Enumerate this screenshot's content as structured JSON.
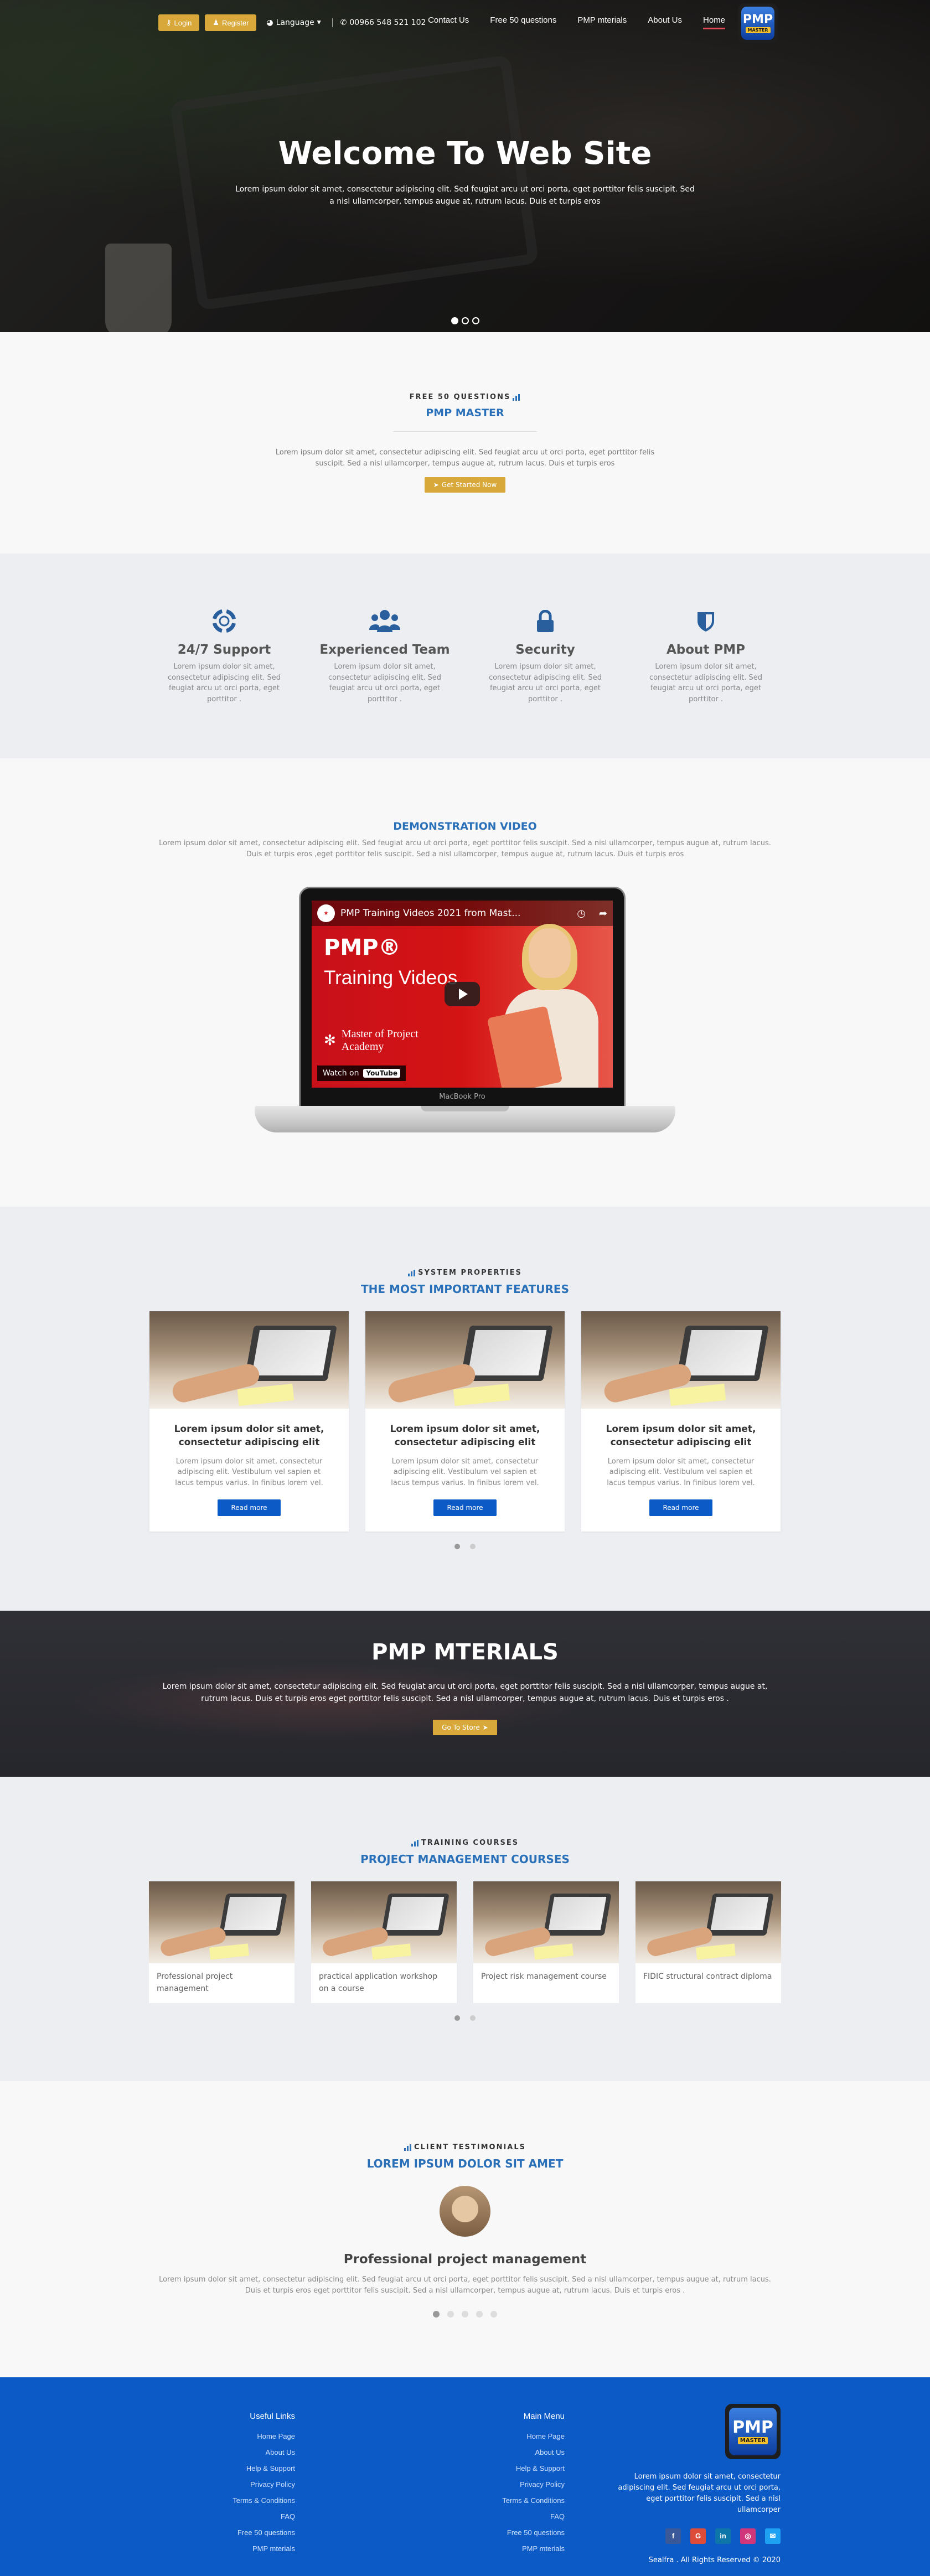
{
  "colors": {
    "gold": "#d8a93a",
    "blue": "#2a70b8",
    "footer_blue": "#0c5ac6",
    "active_underline": "#e84a5f"
  },
  "nav": {
    "login": "Login",
    "register": "Register",
    "language": "Language",
    "phone": "00966 548 521 102",
    "links": [
      "Contact Us",
      "Free 50 questions",
      "PMP mterials",
      "About Us",
      "Home"
    ],
    "active": "Home"
  },
  "logo": {
    "pmp": "PMP",
    "master": "MASTER"
  },
  "hero": {
    "title": "Welcome To Web Site",
    "text": "Lorem ipsum dolor sit amet, consectetur adipiscing elit. Sed feugiat arcu ut orci porta, eget porttitor felis suscipit. Sed a nisl ullamcorper, tempus augue at, rutrum lacus. Duis et turpis eros",
    "active_slide": 1,
    "slides": 3
  },
  "free50": {
    "kicker": "Free 50 questions",
    "title": "PMP MASTER",
    "text": "Lorem ipsum dolor sit amet, consectetur adipiscing elit. Sed feugiat arcu ut orci porta, eget porttitor felis suscipit. Sed a nisl ullamcorper, tempus augue at, rutrum lacus. Duis et turpis eros",
    "button": "Get Started Now"
  },
  "features": [
    {
      "icon": "lifebuoy-icon",
      "title": "24/7 Support",
      "text": "Lorem ipsum dolor sit amet, consectetur adipiscing elit. Sed feugiat arcu ut orci porta, eget porttitor ."
    },
    {
      "icon": "users-icon",
      "title": "Experienced Team",
      "text": "Lorem ipsum dolor sit amet, consectetur adipiscing elit. Sed feugiat arcu ut orci porta, eget porttitor ."
    },
    {
      "icon": "lock-icon",
      "title": "Security",
      "text": "Lorem ipsum dolor sit amet, consectetur adipiscing elit. Sed feugiat arcu ut orci porta, eget porttitor ."
    },
    {
      "icon": "shield-icon",
      "title": "About PMP",
      "text": "Lorem ipsum dolor sit amet, consectetur adipiscing elit. Sed feugiat arcu ut orci porta, eget porttitor ."
    }
  ],
  "video": {
    "title": "DEMONSTRATION VIDEO",
    "text": "Lorem ipsum dolor sit amet, consectetur adipiscing elit. Sed feugiat arcu ut orci porta, eget porttitor felis suscipit. Sed a nisl ullamcorper, tempus augue at, rutrum lacus. Duis et turpis eros ,eget porttitor felis suscipit. Sed a nisl ullamcorper, tempus augue at, rutrum lacus. Duis et turpis eros",
    "yt_title": "PMP Training Videos 2021 from Mast...",
    "yt_line1": "PMP®",
    "yt_line2": "Training Videos",
    "yt_academy": "Master of Project Academy",
    "watch_on": "Watch on",
    "youtube": "YouTube",
    "macbook": "MacBook Pro"
  },
  "props": {
    "kicker": "System Properties",
    "title": "THE MOST IMPORTANT FEATURES",
    "cards": [
      {
        "title": "Lorem ipsum dolor sit amet, consectetur adipiscing elit",
        "text": "Lorem ipsum dolor sit amet, consectetur adipiscing elit. Vestibulum vel sapien et lacus tempus varius. In finibus lorem vel.",
        "button": "Read more"
      },
      {
        "title": "Lorem ipsum dolor sit amet, consectetur adipiscing elit",
        "text": "Lorem ipsum dolor sit amet, consectetur adipiscing elit. Vestibulum vel sapien et lacus tempus varius. In finibus lorem vel.",
        "button": "Read more"
      },
      {
        "title": "Lorem ipsum dolor sit amet, consectetur adipiscing elit",
        "text": "Lorem ipsum dolor sit amet, consectetur adipiscing elit. Vestibulum vel sapien et lacus tempus varius. In finibus lorem vel.",
        "button": "Read more"
      }
    ]
  },
  "materials": {
    "title": "PMP MTERIALS",
    "text": "Lorem ipsum dolor sit amet, consectetur adipiscing elit. Sed feugiat arcu ut orci porta, eget porttitor felis suscipit. Sed a nisl ullamcorper, tempus augue at, rutrum lacus. Duis et turpis eros eget porttitor felis suscipit. Sed a nisl ullamcorper, tempus augue at, rutrum lacus. Duis et turpis eros .",
    "button": "Go To Store"
  },
  "courses": {
    "kicker": "Training Courses",
    "title": "PROJECT MANAGEMENT COURSES",
    "items": [
      "Professional project management",
      "practical application workshop on a course",
      "Project risk management course",
      "FIDIC structural contract diploma"
    ]
  },
  "testimonials": {
    "kicker": "Client Testimonials",
    "title": "LOREM IPSUM DOLOR SIT AMET",
    "name": "Professional project management",
    "text": "Lorem ipsum dolor sit amet, consectetur adipiscing elit. Sed feugiat arcu ut orci porta, eget porttitor felis suscipit. Sed a nisl ullamcorper, tempus augue at, rutrum lacus. Duis et turpis eros eget porttitor felis suscipit. Sed a nisl ullamcorper, tempus augue at, rutrum lacus. Duis et turpis eros .",
    "dots": 5,
    "active_dot": 1
  },
  "footer": {
    "useful_title": "Useful Links",
    "useful_links": [
      "Home Page",
      "About Us",
      "Help & Support",
      "Privacy Policy",
      "Terms & Conditions",
      "FAQ",
      "Free 50 questions",
      "PMP mterials"
    ],
    "main_title": "Main Menu",
    "main_links": [
      "Home Page",
      "About Us",
      "Help & Support",
      "Privacy Policy",
      "Terms & Conditions",
      "FAQ",
      "Free 50 questions",
      "PMP mterials"
    ],
    "about": "Lorem ipsum dolor sit amet, consectetur adipiscing elit. Sed feugiat arcu ut orci porta, eget porttitor felis suscipit. Sed a nisl ullamcorper",
    "socials": [
      {
        "icon": "facebook-icon",
        "glyph": "f",
        "color": "#3b5998"
      },
      {
        "icon": "google-plus-icon",
        "glyph": "G",
        "color": "#dd4b39"
      },
      {
        "icon": "linkedin-icon",
        "glyph": "in",
        "color": "#0e76a8"
      },
      {
        "icon": "instagram-icon",
        "glyph": "◎",
        "color": "#d1367b"
      },
      {
        "icon": "twitter-icon",
        "glyph": "✉",
        "color": "#1da1f2"
      }
    ],
    "copyright": "Sealfra . All Rights Reserved © 2020"
  }
}
